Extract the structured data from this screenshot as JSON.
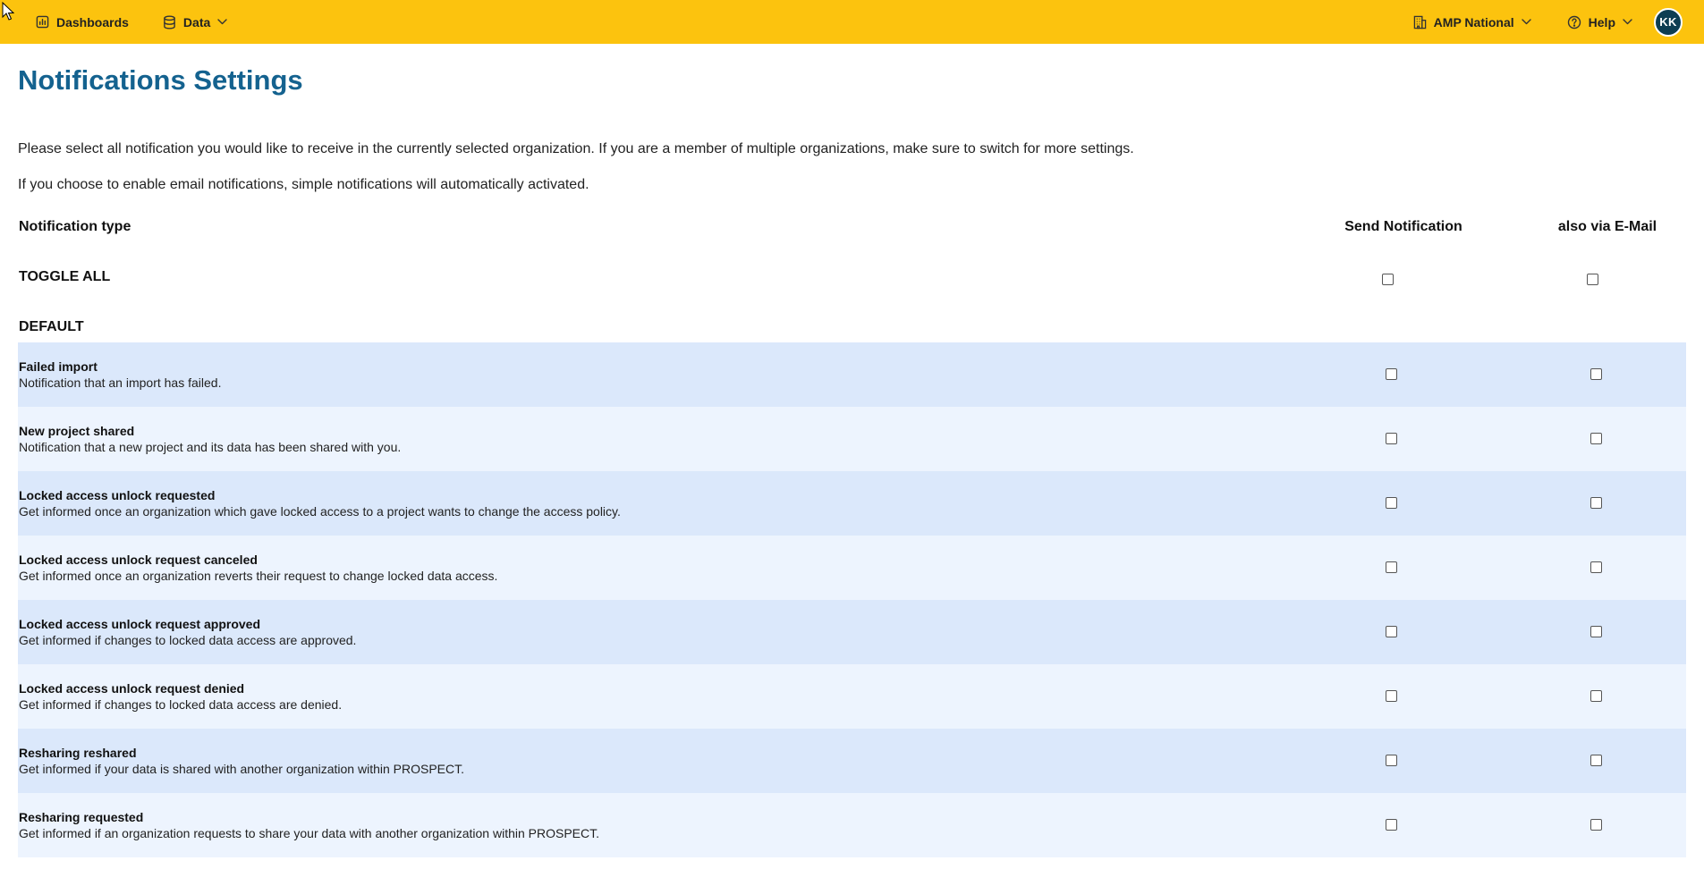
{
  "nav": {
    "dashboards": "Dashboards",
    "data": "Data",
    "org": "AMP National",
    "help": "Help",
    "avatar": "KK"
  },
  "page": {
    "title": "Notifications Settings",
    "intro1": "Please select all notification you would like to receive in the currently selected organization. If you are a member of multiple organizations, make sure to switch for more settings.",
    "intro2": "If you choose to enable email notifications, simple notifications will automatically activated."
  },
  "table": {
    "col_type": "Notification type",
    "col_send": "Send Notification",
    "col_mail": "also via E-Mail",
    "toggle_all": "TOGGLE ALL",
    "section": "DEFAULT",
    "rows": [
      {
        "name": "Failed import",
        "desc": "Notification that an import has failed."
      },
      {
        "name": "New project shared",
        "desc": "Notification that a new project and its data has been shared with you."
      },
      {
        "name": "Locked access unlock requested",
        "desc": "Get informed once an organization which gave locked access to a project wants to change the access policy."
      },
      {
        "name": "Locked access unlock request canceled",
        "desc": "Get informed once an organization reverts their request to change locked data access."
      },
      {
        "name": "Locked access unlock request approved",
        "desc": "Get informed if changes to locked data access are approved."
      },
      {
        "name": "Locked access unlock request denied",
        "desc": "Get informed if changes to locked data access are denied."
      },
      {
        "name": "Resharing reshared",
        "desc": "Get informed if your data is shared with another organization within PROSPECT."
      },
      {
        "name": "Resharing requested",
        "desc": "Get informed if an organization requests to share your data with another organization within PROSPECT."
      }
    ]
  },
  "colors": {
    "topbar": "#fcc30e",
    "title": "#14628f",
    "row_odd": "#dbe8fb",
    "row_even": "#edf4fe",
    "avatar": "#0d3d52"
  }
}
